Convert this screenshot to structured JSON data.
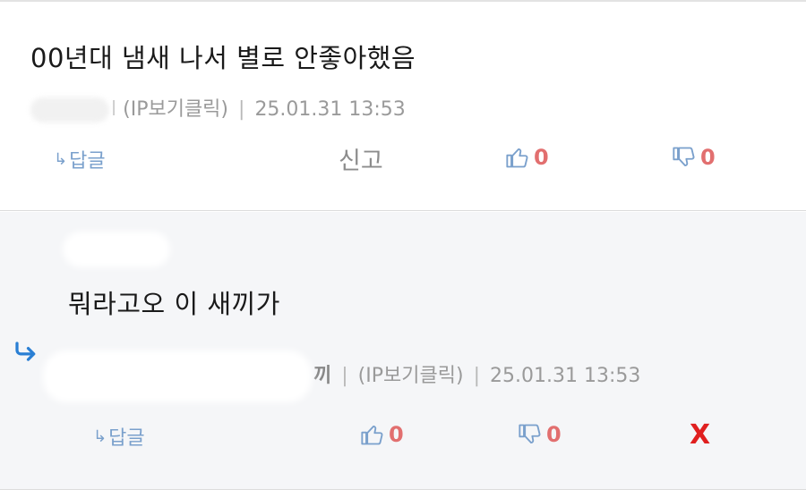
{
  "comment": {
    "text": "00년대 냄새 나서 별로 안좋아했음",
    "name_tail": "l",
    "ip_label": "(IP보기클릭)",
    "timestamp": "25.01.31 13:53",
    "reply_label": "답글",
    "reply_arrow": "↳",
    "report_label": "신고",
    "like_count": "0",
    "dislike_count": "0"
  },
  "reply": {
    "text": "뭐라고오 이 새끼가",
    "name_tail": "끼",
    "ip_label": "(IP보기클릭)",
    "timestamp": "25.01.31 13:53",
    "reply_label": "답글",
    "reply_arrow": "↳",
    "like_count": "0",
    "dislike_count": "0",
    "delete_label": "X"
  },
  "separator": "|",
  "colors": {
    "accent_blue": "#7aa0cc",
    "indicator_blue": "#2a7fd4",
    "count_red": "#e26f6f",
    "delete_red": "#e01f1f",
    "meta_gray": "#9a9a9a",
    "reply_bg": "#f5f6f8"
  },
  "icons": {
    "like": "thumbs-up-icon",
    "dislike": "thumbs-down-icon",
    "reply_indicator": "reply-arrow-icon"
  }
}
